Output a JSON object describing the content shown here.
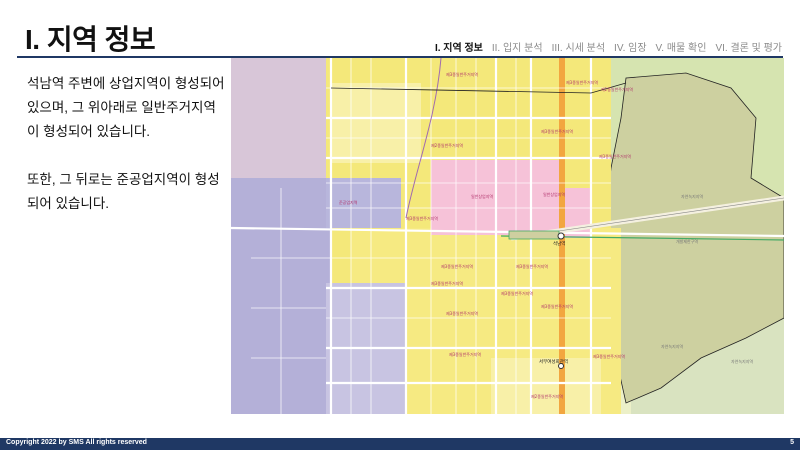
{
  "header": {
    "title": "I. 지역 정보",
    "nav": [
      "I. 지역 정보",
      "II. 입지 분석",
      "III. 시세 분석",
      "IV. 임장",
      "V. 매물 확인",
      "VI. 결론 및 평가"
    ],
    "active_index": 0
  },
  "body": {
    "paragraph1": "석남역 주변에 상업지역이 형성되어 있으며, 그 위아래로 일반주거지역이 형성되어 있습니다.",
    "paragraph2": "또한, 그 뒤로는 준공업지역이 형성되어 있습니다."
  },
  "map": {
    "station_label": "석남역",
    "station2_label": "서부여성회관역",
    "zone_labels": {
      "general_residential_3": "제3종일반주거지역",
      "general_residential_2": "제2종일반주거지역",
      "general_commercial": "일반상업지역",
      "semi_industrial": "준공업지역",
      "natural_green": "자연녹지지역",
      "development_restricted": "개발제한구역"
    }
  },
  "footer": {
    "copyright": "Copyright 2022 by SMS All rights reserved",
    "page_number": "5"
  },
  "colors": {
    "accent": "#1f3864",
    "residential": "#f4e87a",
    "commercial": "#f6c2d8",
    "industrial": "#b4b0d8",
    "green": "#cfe0a8"
  }
}
